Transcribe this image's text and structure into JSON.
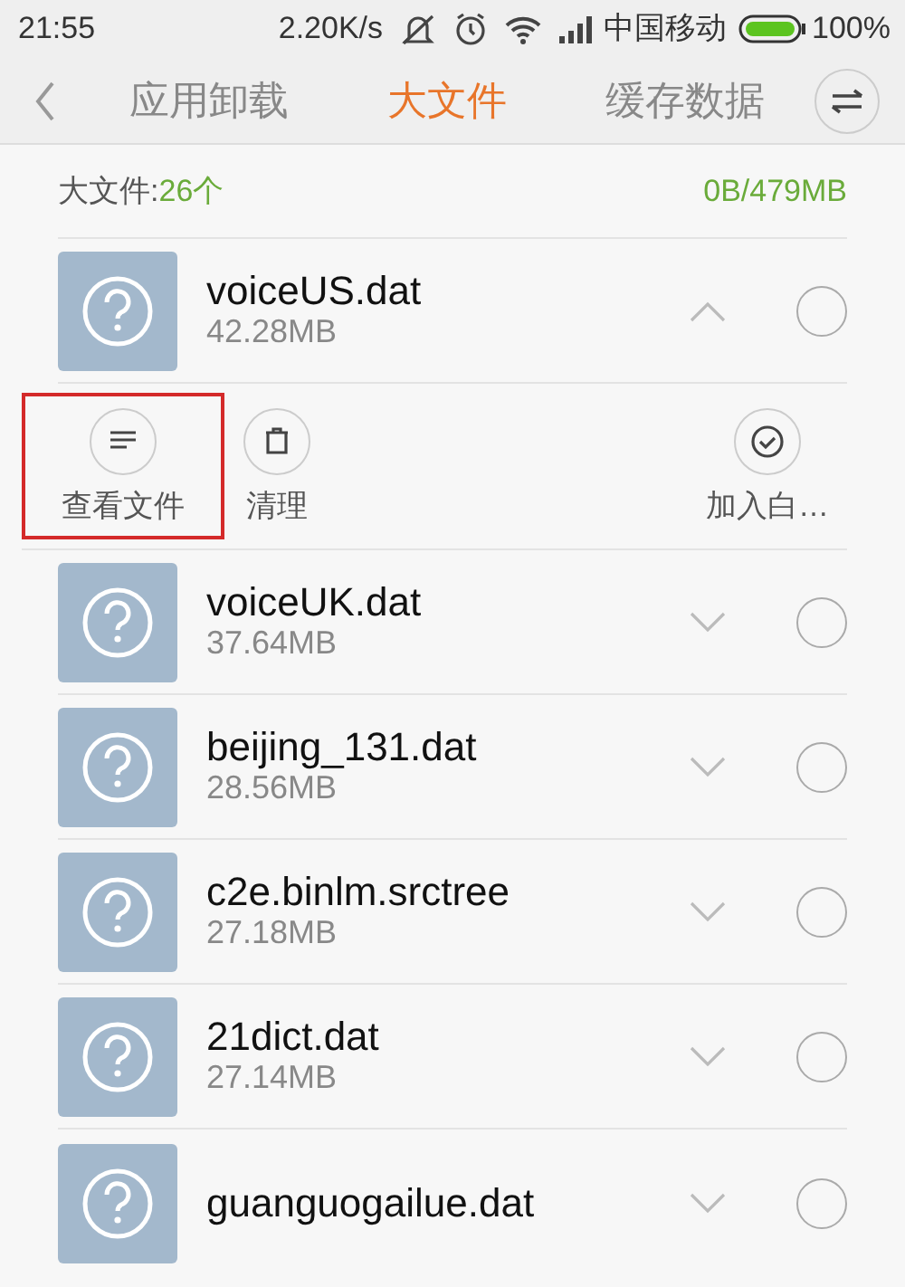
{
  "status_bar": {
    "time": "21:55",
    "speed": "2.20K/s",
    "carrier": "中国移动",
    "battery": "100%"
  },
  "tabs": [
    {
      "label": "应用卸载",
      "selected": false
    },
    {
      "label": "大文件",
      "selected": true
    },
    {
      "label": "缓存数据",
      "selected": false
    }
  ],
  "summary": {
    "label": "大文件:",
    "count": "26个",
    "size": "0B/479MB"
  },
  "files": [
    {
      "name": "voiceUS.dat",
      "size": "42.28MB",
      "expanded": true,
      "checked": false,
      "actions": [
        {
          "kind": "view",
          "label": "查看文件",
          "highlighted": true
        },
        {
          "kind": "clean",
          "label": "清理",
          "highlighted": false
        },
        {
          "kind": "whitelist",
          "label": "加入白…",
          "highlighted": false
        }
      ]
    },
    {
      "name": "voiceUK.dat",
      "size": "37.64MB",
      "expanded": false,
      "checked": false
    },
    {
      "name": "beijing_131.dat",
      "size": "28.56MB",
      "expanded": false,
      "checked": false
    },
    {
      "name": "c2e.binlm.srctree",
      "size": "27.18MB",
      "expanded": false,
      "checked": false
    },
    {
      "name": "21dict.dat",
      "size": "27.14MB",
      "expanded": false,
      "checked": false
    },
    {
      "name": "guanguogailue.dat",
      "expanded": false,
      "checked": false
    }
  ]
}
